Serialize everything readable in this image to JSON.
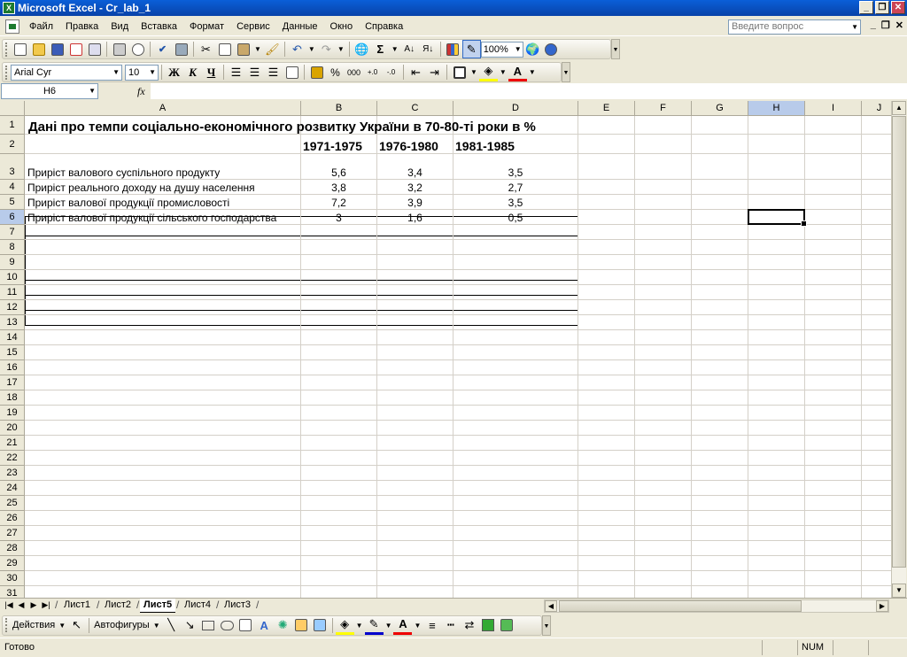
{
  "window": {
    "title": "Microsoft Excel - Cr_lab_1"
  },
  "menu": {
    "items": [
      "Файл",
      "Правка",
      "Вид",
      "Вставка",
      "Формат",
      "Сервис",
      "Данные",
      "Окно",
      "Справка"
    ],
    "help_placeholder": "Введите вопрос"
  },
  "toolbar": {
    "zoom": "100%",
    "font_name": "Arial Cyr",
    "font_size": "10",
    "bold": "Ж",
    "italic": "К",
    "underline": "Ч",
    "percent": "%",
    "thousands": "000",
    "sum_icon": "Σ"
  },
  "formula_bar": {
    "name_box": "H6",
    "fx_label": "fx",
    "value": ""
  },
  "sheet": {
    "columns": [
      "A",
      "B",
      "C",
      "D",
      "E",
      "F",
      "G",
      "H",
      "I",
      "J"
    ],
    "selected_column": "H",
    "rows": [
      "1",
      "2",
      "3",
      "4",
      "5",
      "6",
      "7",
      "8",
      "9",
      "10",
      "11",
      "12",
      "13",
      "14",
      "15",
      "16",
      "17",
      "18",
      "19",
      "20",
      "21",
      "22",
      "23",
      "24",
      "25",
      "26",
      "27",
      "28",
      "29",
      "30",
      "31"
    ],
    "title": "Дані про темпи соціально-економічного розвитку України в 70-80-ті роки в %",
    "period_headers": [
      "1971-1975",
      "1976-1980",
      "1981-1985"
    ],
    "data_rows": [
      {
        "label": "Приріст валового суспільного продукту",
        "values": [
          "5,6",
          "3,4",
          "3,5"
        ]
      },
      {
        "label": "Приріст реального доходу на душу населення",
        "values": [
          "3,8",
          "3,2",
          "2,7"
        ]
      },
      {
        "label": "Приріст валової продукції промисловості",
        "values": [
          "7,2",
          "3,9",
          "3,5"
        ]
      },
      {
        "label": "Приріст валової продукції сільського господарства",
        "values": [
          "3",
          "1,6",
          "0,5"
        ]
      }
    ]
  },
  "sheet_tabs": {
    "tabs": [
      "Лист1",
      "Лист2",
      "Лист5",
      "Лист4",
      "Лист3"
    ],
    "active": "Лист5"
  },
  "drawing": {
    "actions_label": "Действия",
    "autoshapes_label": "Автофигуры"
  },
  "status": {
    "text": "Готово",
    "num": "NUM"
  }
}
